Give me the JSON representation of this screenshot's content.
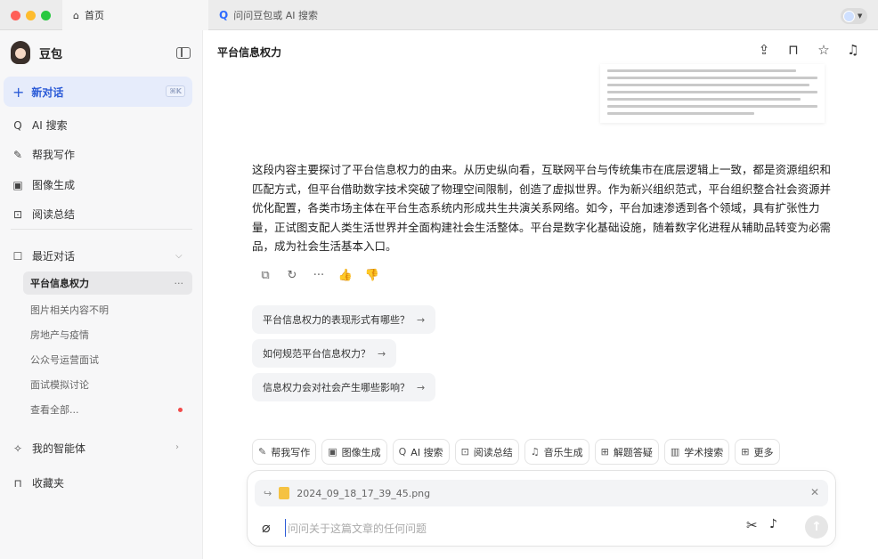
{
  "window": {
    "tabs": [
      {
        "icon": "home-icon",
        "label": "首页"
      },
      {
        "icon": "ai-search-icon",
        "label": "问问豆包或 AI 搜索"
      }
    ]
  },
  "sidebar": {
    "brand": "豆包",
    "new_chat": {
      "label": "新对话",
      "shortcut": "⌘K"
    },
    "items": [
      {
        "icon": "ai-search-icon",
        "label": "AI 搜索"
      },
      {
        "icon": "pen-icon",
        "label": "帮我写作"
      },
      {
        "icon": "image-icon",
        "label": "图像生成"
      },
      {
        "icon": "read-icon",
        "label": "阅读总结"
      }
    ],
    "recent": {
      "title": "最近对话",
      "active": "平台信息权力",
      "active_more": "···",
      "items": [
        "图片相关内容不明",
        "房地产与疫情",
        "公众号运营面试",
        "面试模拟讨论"
      ],
      "view_all": "查看全部..."
    },
    "agents": "我的智能体",
    "favorites": "收藏夹"
  },
  "header": {
    "title": "平台信息权力"
  },
  "answer": {
    "text": "这段内容主要探讨了平台信息权力的由来。从历史纵向看，互联网平台与传统集市在底层逻辑上一致，都是资源组织和匹配方式，但平台借助数字技术突破了物理空间限制，创造了虚拟世界。作为新兴组织范式，平台组织整合社会资源并优化配置，各类市场主体在平台生态系统内形成共生共演关系网络。如今，平台加速渗透到各个领域，具有扩张性力量，正试图支配人类生活世界并全面构建社会生活整体。平台是数字化基础设施，随着数字化进程从辅助品转变为必需品，成为社会生活基本入口。"
  },
  "suggestions": [
    "平台信息权力的表现形式有哪些？",
    "如何规范平台信息权力？",
    "信息权力会对社会产生哪些影响？"
  ],
  "suggestion_arrow": "→",
  "chips": [
    {
      "icon": "pen-icon",
      "label": "帮我写作"
    },
    {
      "icon": "image-icon",
      "label": "图像生成"
    },
    {
      "icon": "ai-search-icon",
      "label": "AI 搜索"
    },
    {
      "icon": "read-icon",
      "label": "阅读总结"
    },
    {
      "icon": "music-icon",
      "label": "音乐生成"
    },
    {
      "icon": "solve-icon",
      "label": "解题答疑"
    },
    {
      "icon": "scholar-icon",
      "label": "学术搜索"
    },
    {
      "icon": "more-icon",
      "label": "更多"
    }
  ],
  "composer": {
    "attachment": "2024_09_18_17_39_45.png",
    "placeholder": "问问关于这篇文章的任何问题"
  }
}
